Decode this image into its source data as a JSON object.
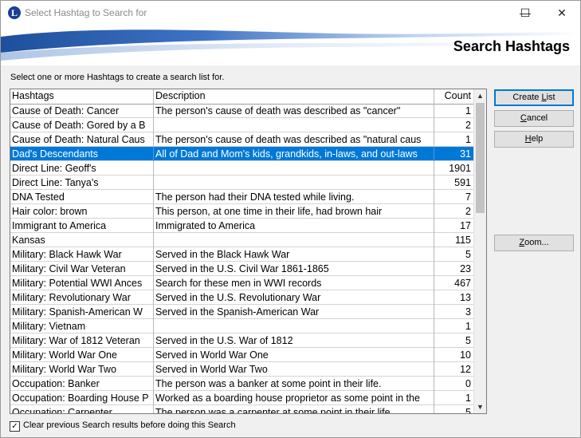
{
  "window": {
    "title": "Select Hashtag to Search for",
    "icon_letter": "L",
    "controls": {
      "minimize": "—",
      "maximize": "☐",
      "close": "✕"
    }
  },
  "banner": {
    "title": "Search Hashtags"
  },
  "instruction": "Select one or more Hashtags to create a search list for.",
  "table": {
    "columns": [
      "Hashtags",
      "Description",
      "Count"
    ],
    "rows": [
      {
        "tag": "Cause of Death: Cancer",
        "desc": "The person's cause of death was described as \"cancer\"",
        "count": "1"
      },
      {
        "tag": "Cause of Death: Gored by a B",
        "desc": "",
        "count": "2"
      },
      {
        "tag": "Cause of Death: Natural Caus",
        "desc": "The person's cause of death was described as \"natural caus",
        "count": "1"
      },
      {
        "tag": "Dad's Descendants",
        "desc": "All of Dad and Mom's kids, grandkids, in-laws, and out-laws",
        "count": "31",
        "selected": true
      },
      {
        "tag": "Direct Line: Geoff's",
        "desc": "",
        "count": "1901"
      },
      {
        "tag": "Direct Line: Tanya's",
        "desc": "",
        "count": "591"
      },
      {
        "tag": "DNA Tested",
        "desc": "The person had their DNA tested while living.",
        "count": "7"
      },
      {
        "tag": "Hair color: brown",
        "desc": "This person, at one time in their life, had brown hair",
        "count": "2"
      },
      {
        "tag": "Immigrant to America",
        "desc": "Immigrated to America",
        "count": "17"
      },
      {
        "tag": "Kansas",
        "desc": "",
        "count": "115"
      },
      {
        "tag": "Military: Black Hawk War",
        "desc": "Served in the Black Hawk War",
        "count": "5"
      },
      {
        "tag": "Military: Civil War Veteran",
        "desc": "Served in the U.S. Civil War 1861-1865",
        "count": "23"
      },
      {
        "tag": "Military: Potential WWI Ances",
        "desc": "Search for these men in WWI records",
        "count": "467"
      },
      {
        "tag": "Military: Revolutionary War",
        "desc": "Served in the U.S. Revolutionary War",
        "count": "13"
      },
      {
        "tag": "Military: Spanish-American W",
        "desc": "Served in the Spanish-American War",
        "count": "3"
      },
      {
        "tag": "Military: Vietnam",
        "desc": "",
        "count": "1"
      },
      {
        "tag": "Military: War of 1812 Veteran",
        "desc": "Served in the U.S. War of 1812",
        "count": "5"
      },
      {
        "tag": "Military: World War One",
        "desc": "Served in World War One",
        "count": "10"
      },
      {
        "tag": "Military: World War Two",
        "desc": "Served in World War Two",
        "count": "12"
      },
      {
        "tag": "Occupation: Banker",
        "desc": "The person was a banker at some point in their life.",
        "count": "0"
      },
      {
        "tag": "Occupation: Boarding House P",
        "desc": "Worked as a boarding house proprietor as some point in the",
        "count": "1"
      },
      {
        "tag": "Occupation: Carpenter",
        "desc": "The person was a carpenter at some point in their life.",
        "count": "5"
      }
    ]
  },
  "scrollbar": {
    "up": "▲",
    "down": "▼"
  },
  "buttons": {
    "create_list": {
      "pre": "Create ",
      "key": "L",
      "post": "ist"
    },
    "cancel": {
      "pre": "",
      "key": "C",
      "post": "ancel"
    },
    "help": {
      "pre": "",
      "key": "H",
      "post": "elp"
    },
    "zoom": {
      "pre": "",
      "key": "Z",
      "post": "oom..."
    }
  },
  "checkbox": {
    "checked": true,
    "mark": "✓",
    "label": "Clear previous Search results before doing this Search"
  },
  "colors": {
    "selection": "#0078d7",
    "banner_swoosh": "#2a5cb0",
    "default_button_border": "#0078d7"
  }
}
